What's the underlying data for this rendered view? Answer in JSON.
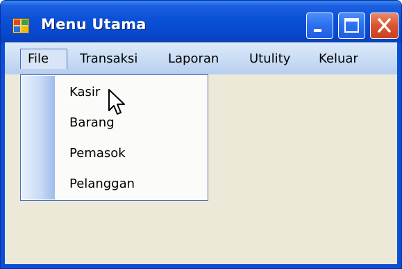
{
  "window": {
    "title": "Menu Utama"
  },
  "menubar": {
    "items": [
      {
        "label": "File",
        "open": true
      },
      {
        "label": "Transaksi"
      },
      {
        "label": "Laporan"
      },
      {
        "label": "Utulity"
      },
      {
        "label": "Keluar"
      }
    ]
  },
  "dropdown": {
    "items": [
      {
        "label": "Kasir"
      },
      {
        "label": "Barang"
      },
      {
        "label": "Pemasok"
      },
      {
        "label": "Pelanggan"
      }
    ]
  },
  "colors": {
    "titlebar": "#0a50d8",
    "client_background": "#ece9d8",
    "menubar": "#c8dcf4",
    "close_button": "#d9542f"
  },
  "icons": [
    "app-icon",
    "minimize-icon",
    "maximize-icon",
    "close-icon",
    "mouse-pointer-icon"
  ]
}
